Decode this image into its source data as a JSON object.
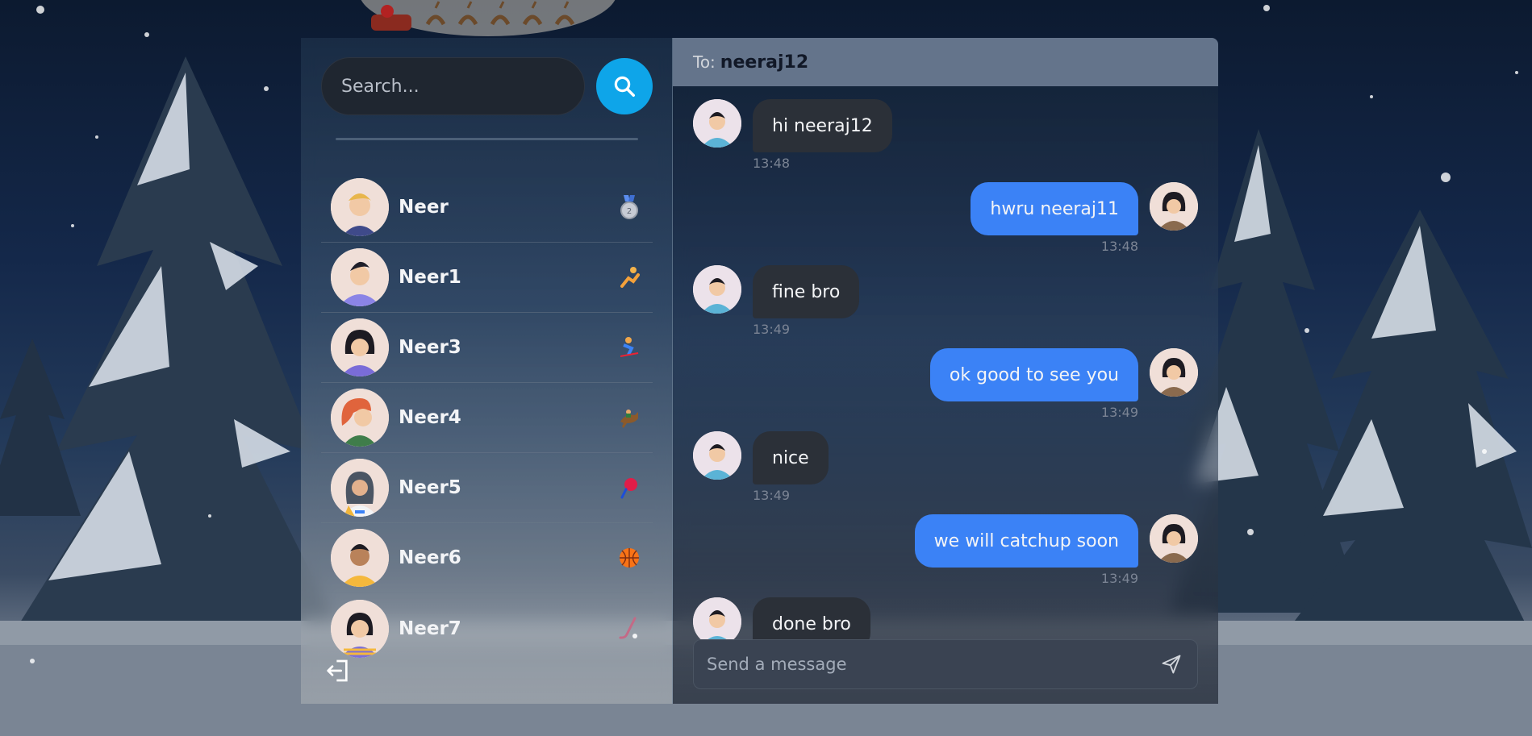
{
  "search": {
    "placeholder": "Search..."
  },
  "users": [
    {
      "name": "Neer",
      "emoji_icon": "medal-2-icon",
      "avatar": "man-blonde-avatar"
    },
    {
      "name": "Neer1",
      "emoji_icon": "gymnast-icon",
      "avatar": "man-purple-hoodie-avatar"
    },
    {
      "name": "Neer3",
      "emoji_icon": "skier-icon",
      "avatar": "woman-purple-avatar"
    },
    {
      "name": "Neer4",
      "emoji_icon": "horse-racing-icon",
      "avatar": "woman-redhead-avatar"
    },
    {
      "name": "Neer5",
      "emoji_icon": "ping-pong-icon",
      "avatar": "woman-hijab-avatar"
    },
    {
      "name": "Neer6",
      "emoji_icon": "basketball-icon",
      "avatar": "man-yellow-shirt-avatar"
    },
    {
      "name": "Neer7",
      "emoji_icon": "hockey-stick-icon",
      "avatar": "woman-striped-avatar"
    }
  ],
  "chat": {
    "to_label": "To:",
    "to_name": "neeraj12",
    "messages": [
      {
        "direction": "in",
        "text": "hi neeraj12",
        "time": "13:48"
      },
      {
        "direction": "out",
        "text": "hwru neeraj11",
        "time": "13:48"
      },
      {
        "direction": "in",
        "text": "fine bro",
        "time": "13:49"
      },
      {
        "direction": "out",
        "text": "ok good to see you",
        "time": "13:49"
      },
      {
        "direction": "in",
        "text": "nice",
        "time": "13:49"
      },
      {
        "direction": "out",
        "text": "we will catchup soon",
        "time": "13:49"
      },
      {
        "direction": "in",
        "text": "done bro",
        "time": ""
      }
    ],
    "composer_placeholder": "Send a message"
  },
  "colors": {
    "accent": "#0ea5e9",
    "outgoing_bubble": "#3b82f6",
    "incoming_bubble": "#2b3038",
    "header_bg": "#64748b"
  }
}
